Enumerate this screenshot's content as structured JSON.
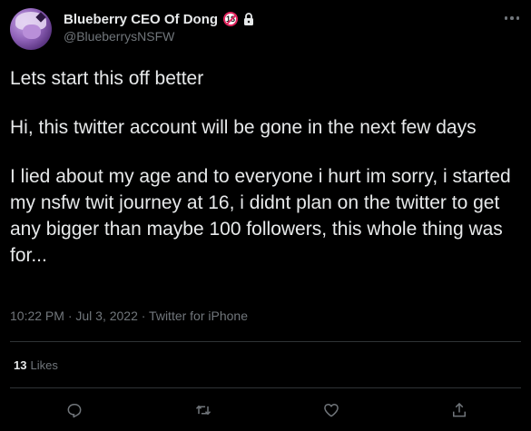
{
  "author": {
    "display_name": "Blueberry CEO Of Dong",
    "handle": "@BlueberrysNSFW",
    "badge_text": "18"
  },
  "tweet": {
    "paragraphs": [
      "Lets start this off better",
      "Hi, this twitter account will be gone in the next few days",
      "I lied about my age and to everyone i hurt im sorry, i started my nsfw twit journey at 16, i didnt plan on the twitter to get any bigger than maybe 100 followers, this whole thing was for..."
    ],
    "meta": "10:22 PM · Jul 3, 2022 · Twitter for iPhone"
  },
  "stats": {
    "likes_count": "13",
    "likes_label": "Likes"
  },
  "actions": {
    "icons": [
      "reply-icon",
      "retweet-icon",
      "like-icon",
      "share-icon"
    ]
  },
  "colors": {
    "background": "#000000",
    "text": "#e7e9ea",
    "secondary": "#71767b",
    "divider": "#2f3336",
    "badge_red": "#e0245e"
  }
}
